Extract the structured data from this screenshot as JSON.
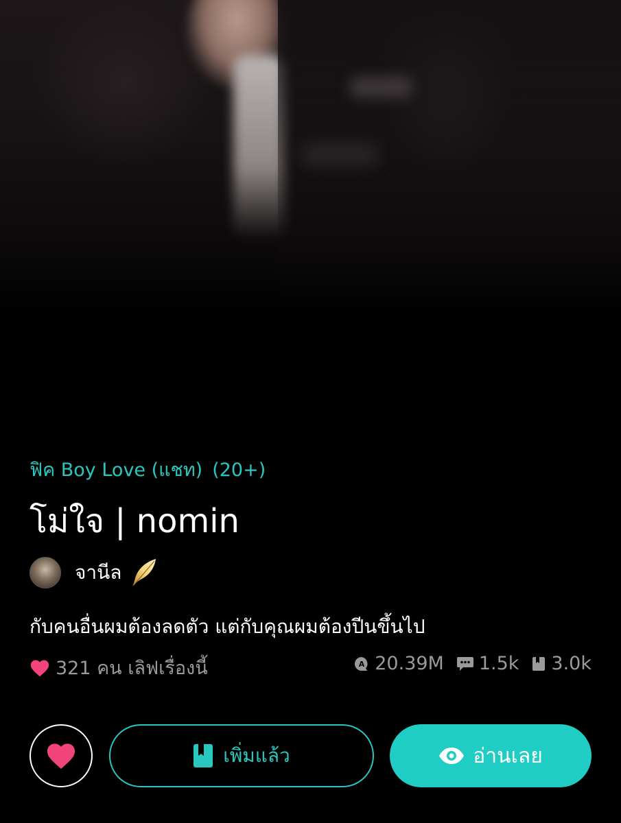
{
  "story": {
    "category": "ฟิค Boy Love (แชท)",
    "age_rating": "(20+)",
    "title": "โม่ใจ | nomin",
    "tagline": "กับคนอื่นผมต้องลดตัว แต่กับคุณผมต้องปีนขึ้นไป"
  },
  "author": {
    "name": "จานีล",
    "badge_icon": "gold-quill-icon"
  },
  "stats": {
    "love_text": "321 คน เลิฟเรื่องนี้",
    "views": "20.39M",
    "comments": "1.5k",
    "bookmarks": "3.0k"
  },
  "actions": {
    "added_label": "เพิ่มแล้ว",
    "read_label": "อ่านเลย"
  },
  "colors": {
    "accent": "#28c8c0",
    "read_button": "#1fcdc4",
    "heart": "#f0447a",
    "muted": "#9a9a9a",
    "background": "#000000"
  }
}
